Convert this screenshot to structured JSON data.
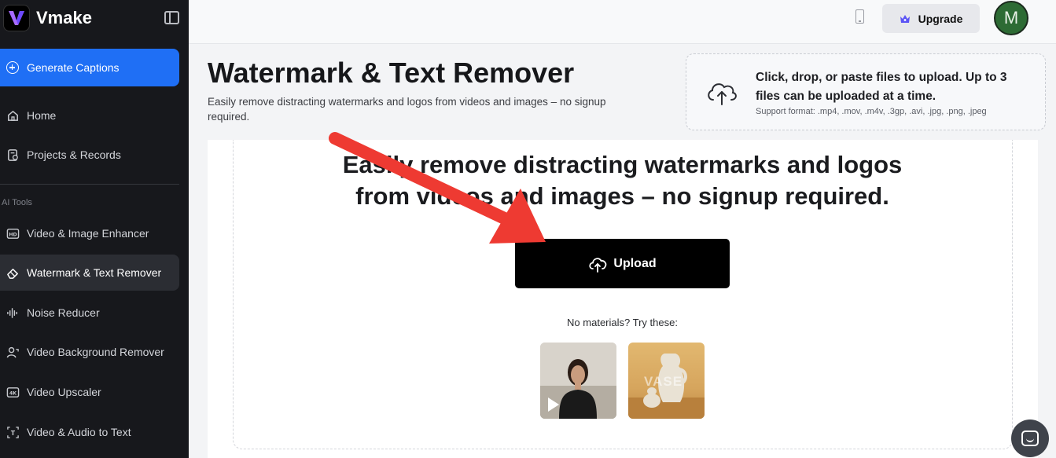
{
  "app": {
    "name": "Vmake"
  },
  "sidebar": {
    "primary_button": "Generate Captions",
    "items": [
      {
        "label": "Home",
        "icon": "home-icon"
      },
      {
        "label": "Projects & Records",
        "icon": "projects-icon"
      }
    ],
    "section_label": "AI Tools",
    "tools": [
      {
        "label": "Video & Image Enhancer",
        "icon": "hd-icon"
      },
      {
        "label": "Watermark & Text Remover",
        "icon": "eraser-icon",
        "active": true
      },
      {
        "label": "Noise Reducer",
        "icon": "waveform-icon"
      },
      {
        "label": "Video Background Remover",
        "icon": "person-remove-icon"
      },
      {
        "label": "Video Upscaler",
        "icon": "4k-icon"
      },
      {
        "label": "Video & Audio to Text",
        "icon": "text-box-icon"
      }
    ]
  },
  "topbar": {
    "upgrade_label": "Upgrade",
    "avatar_initial": "M"
  },
  "header": {
    "title": "Watermark & Text Remover",
    "description": "Easily remove distracting watermarks and logos from videos and images – no signup required."
  },
  "upload_zone": {
    "title": "Click, drop, or paste files to upload. Up to 3 files can be uploaded at a time.",
    "formats": "Support format: .mp4, .mov, .m4v, .3gp, .avi, .jpg, .png, .jpeg"
  },
  "main": {
    "hero_line_1": "Easily remove distracting watermarks and logos",
    "hero_line_2": "from videos and images – no signup required.",
    "upload_label": "Upload",
    "try_text": "No materials? Try these:",
    "sample_2_text": "VASE"
  },
  "colors": {
    "accent": "#1f6ff5",
    "sidebar_bg": "#17181c",
    "arrow": "#ee3a32"
  }
}
